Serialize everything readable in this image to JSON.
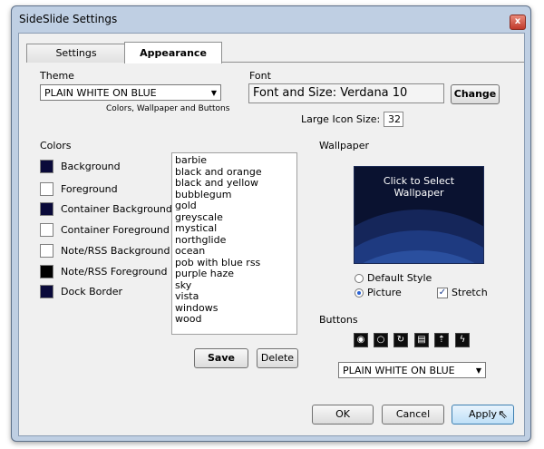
{
  "window": {
    "title": "SideSlide Settings",
    "close_glyph": "x"
  },
  "tabs": [
    {
      "label": "Settings"
    },
    {
      "label": "Appearance"
    }
  ],
  "theme": {
    "label": "Theme",
    "value": "PLAIN WHITE ON BLUE",
    "hint": "Colors, Wallpaper and Buttons"
  },
  "font": {
    "label": "Font",
    "value": "Font and Size: Verdana 10",
    "change_button": "Change",
    "large_icon_label": "Large Icon Size:",
    "large_icon_value": "32"
  },
  "colors": {
    "label": "Colors",
    "items": [
      {
        "label": "Background",
        "color": "#0a0a3a"
      },
      {
        "label": "Foreground",
        "color": "#ffffff"
      },
      {
        "label": "Container Background",
        "color": "#0a0a3a"
      },
      {
        "label": "Container Foreground",
        "color": "#ffffff"
      },
      {
        "label": "Note/RSS Background",
        "color": "#ffffff"
      },
      {
        "label": "Note/RSS Foreground",
        "color": "#000000"
      },
      {
        "label": "Dock Border",
        "color": "#0a0a3a"
      }
    ]
  },
  "themes_list": [
    "barbie",
    "black and orange",
    "black and yellow",
    "bubblegum",
    "gold",
    "greyscale",
    "mystical",
    "northglide",
    "ocean",
    "pob with blue rss",
    "purple haze",
    "sky",
    "vista",
    "windows",
    "wood"
  ],
  "list_buttons": {
    "save": "Save",
    "delete": "Delete"
  },
  "wallpaper": {
    "label": "Wallpaper",
    "preview_text": "Click to Select Wallpaper",
    "default_style": "Default Style",
    "picture": "Picture",
    "picture_selected": true,
    "stretch": "Stretch",
    "stretch_checked": true
  },
  "buttons": {
    "label": "Buttons",
    "icons": [
      "target-icon",
      "circle-icon",
      "refresh-icon",
      "document-icon",
      "upload-icon",
      "lightning-icon"
    ],
    "style_value": "PLAIN WHITE ON BLUE"
  },
  "footer": {
    "ok": "OK",
    "cancel": "Cancel",
    "apply": "Apply"
  }
}
